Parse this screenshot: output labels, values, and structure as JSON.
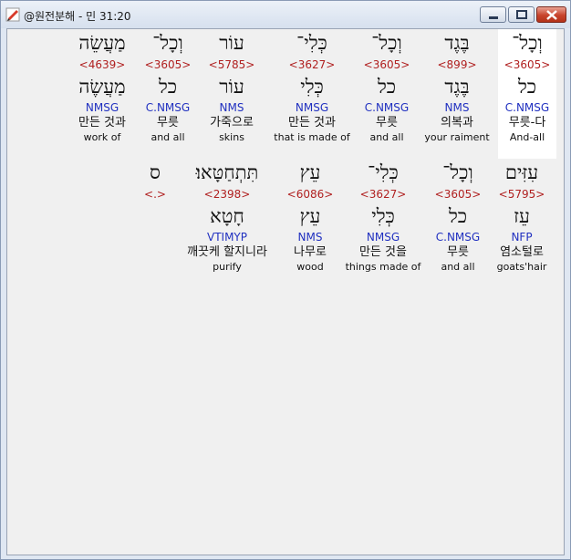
{
  "window": {
    "title": "@원전분해 - 민 31:20"
  },
  "line1": [
    {
      "heb": "וְכָל־",
      "code": "<3605>",
      "lemma": "כל",
      "parse": "C.NMSG",
      "ko": "무릇-다",
      "en": "And-all"
    },
    {
      "heb": "בֶּגֶד",
      "code": "<899>",
      "lemma": "בֶּגֶד",
      "parse": "NMS",
      "ko": "의복과",
      "en": "your raiment"
    },
    {
      "heb": "וְכָל־",
      "code": "<3605>",
      "lemma": "כל",
      "parse": "C.NMSG",
      "ko": "무릇",
      "en": "and all"
    },
    {
      "heb": "כְּלִי־",
      "code": "<3627>",
      "lemma": "כְּלִי",
      "parse": "NMSG",
      "ko": "만든 것과",
      "en": "that is made of"
    },
    {
      "heb": "עוֹר",
      "code": "<5785>",
      "lemma": "עוֹר",
      "parse": "NMS",
      "ko": "가죽으로",
      "en": "skins"
    },
    {
      "heb": "וְכָל־",
      "code": "<3605>",
      "lemma": "כל",
      "parse": "C.NMSG",
      "ko": "무릇",
      "en": "and all"
    },
    {
      "heb": "מַעֲשֵׂה",
      "code": "<4639>",
      "lemma": "מַעֲשֶׂה",
      "parse": "NMSG",
      "ko": "만든 것과",
      "en": "work of"
    }
  ],
  "line2": [
    {
      "heb": "עִזִּים",
      "code": "<5795>",
      "lemma": "עֵז",
      "parse": "NFP",
      "ko": "염소털로",
      "en": "goats'hair"
    },
    {
      "heb": "וְכָל־",
      "code": "<3605>",
      "lemma": "כל",
      "parse": "C.NMSG",
      "ko": "무릇",
      "en": "and all"
    },
    {
      "heb": "כְּלִי־",
      "code": "<3627>",
      "lemma": "כְּלִי",
      "parse": "NMSG",
      "ko": "만든 것을",
      "en": "things made of"
    },
    {
      "heb": "עֵץ",
      "code": "<6086>",
      "lemma": "עֵץ",
      "parse": "NMS",
      "ko": "나무로",
      "en": "wood"
    },
    {
      "heb": "תִּתְחַטָּאוּ׃",
      "code": "<2398>",
      "lemma": "חָטָא",
      "parse": "VTIMYP",
      "ko": "깨끗케 할지니라",
      "en": "purify"
    },
    {
      "heb": "ס",
      "code": "<.>",
      "lemma": "",
      "parse": "",
      "ko": "",
      "en": ""
    }
  ]
}
